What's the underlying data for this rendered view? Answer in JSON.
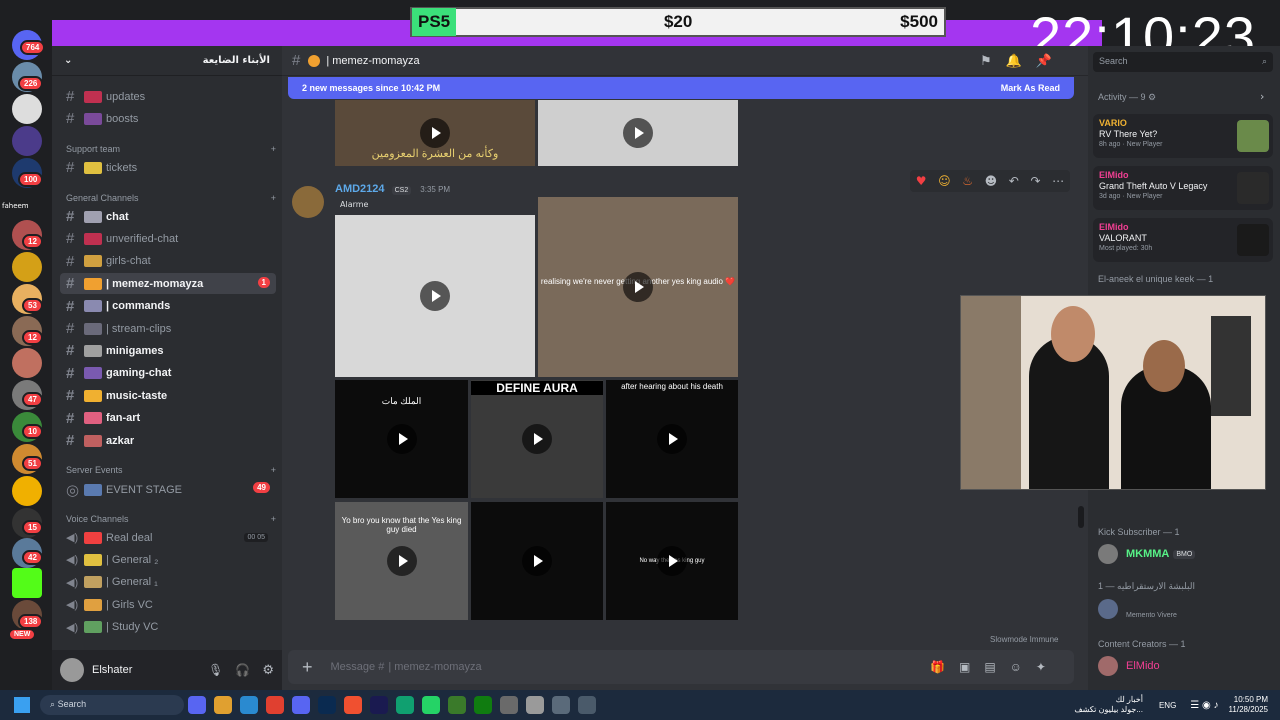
{
  "overlay": {
    "game": "PS5",
    "mid": "$20",
    "right": "$500",
    "clock": "22:10:23"
  },
  "rail": {
    "badges": [
      "764",
      "226",
      "100",
      "12",
      "53",
      "12",
      "47",
      "10",
      "51",
      "15",
      "42",
      "138",
      "NEW"
    ],
    "label": "faheem"
  },
  "guild": {
    "name": "الأبناء الضايعة"
  },
  "channels": {
    "top": [
      "updates",
      "boosts"
    ],
    "support_cat": "Support team",
    "support": [
      "tickets"
    ],
    "general_cat": "General Channels",
    "general": [
      {
        "name": "chat",
        "bold": true
      },
      {
        "name": "unverified-chat",
        "bold": false
      },
      {
        "name": "girls-chat",
        "bold": false
      },
      {
        "name": "| memez-momayza",
        "bold": true,
        "active": true,
        "badge": "1"
      },
      {
        "name": "| commands",
        "bold": true
      },
      {
        "name": "| stream-clips",
        "bold": false
      },
      {
        "name": "minigames",
        "bold": true
      },
      {
        "name": "gaming-chat",
        "bold": true
      },
      {
        "name": "music-taste",
        "bold": true
      },
      {
        "name": "fan-art",
        "bold": true
      },
      {
        "name": "azkar",
        "bold": true
      }
    ],
    "events_cat": "Server Events",
    "events": [
      {
        "name": "EVENT STAGE",
        "badge": "49"
      }
    ],
    "voice_cat": "Voice Channels",
    "voice": [
      {
        "name": "Real deal",
        "tag": "00 05"
      },
      {
        "name": "| General ₂"
      },
      {
        "name": "| General ₁"
      },
      {
        "name": "| Girls VC"
      },
      {
        "name": "| Study VC"
      }
    ]
  },
  "user": {
    "name": "Elshater"
  },
  "chat": {
    "channel": "| memez-momayza",
    "banner": "2 new messages since 10:42 PM",
    "mark_read": "Mark As Read",
    "top_caption": "وكأنه من العشرة المعزومين",
    "author": "AMD2124",
    "author_tag": "CS2",
    "time": "3:35 PM",
    "alarm": "Alarme",
    "captions": {
      "v2": "realising we're never getting another yes king audio ❤️",
      "v3": "الملك مات",
      "v4": "DEFINE AURA",
      "v5": "after hearing about his death",
      "v6": "Yo bro you know that the Yes king guy died",
      "v8": "No way the yes king guy"
    },
    "slowmode": "Slowmode Immune",
    "composer_prefix": "Message #",
    "composer_channel": "| memez-momayza"
  },
  "search": {
    "placeholder": "Search"
  },
  "activity": {
    "title": "Activity — 9",
    "items": [
      {
        "user": "VARIO",
        "game": "RV There Yet?",
        "sub": "8h ago · New Player",
        "color": "#f0b232"
      },
      {
        "user": "ElMido",
        "game": "Grand Theft Auto V Legacy",
        "sub": "3d ago · New Player",
        "color": "#f23f93"
      },
      {
        "user": "ElMido",
        "game": "VALORANT",
        "sub": "Most played: 30h",
        "color": "#f23f93"
      }
    ]
  },
  "members": {
    "sec1": "El-aneek el unique keek — 1",
    "kick_sec": "Kick Subscriber — 1",
    "kick_user": "MKMMA",
    "kick_tag": "BMO",
    "arab_sec": "1 — البلبشة الارستقراطيه",
    "arab_user": "Memento Vivere",
    "cc_sec": "Content Creators — 1",
    "cc_user": "ElMido"
  },
  "taskbar": {
    "search": "Search",
    "lang": "ENG",
    "time": "10:50 PM",
    "date": "11/28/2025",
    "news": "أخبار لك",
    "news2": "جولد بيليون تكشف..."
  }
}
